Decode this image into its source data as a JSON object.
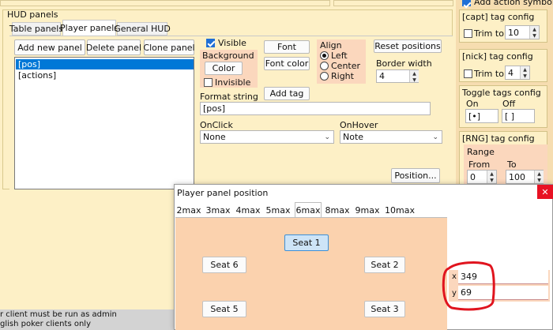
{
  "hud_panels": {
    "title": "HUD panels",
    "tabs": [
      {
        "label": "Table panels"
      },
      {
        "label": "Player panels"
      },
      {
        "label": "General HUD"
      }
    ],
    "buttons": {
      "add_new_panel": "Add new panel",
      "delete_panel": "Delete panel",
      "clone_panel": "Clone panel"
    },
    "panel_list": [
      "[pos]",
      "[actions]"
    ],
    "visible_label": "Visible",
    "background": {
      "title": "Background",
      "color_button": "Color",
      "invisible_label": "Invisible"
    },
    "font_button": "Font",
    "font_color_button": "Font color",
    "add_tag_button": "Add tag",
    "align": {
      "title": "Align",
      "options": [
        "Left",
        "Center",
        "Right"
      ],
      "selected": "Left"
    },
    "reset_positions_button": "Reset positions",
    "border_width": {
      "label": "Border width",
      "value": "4"
    },
    "format_string": {
      "label": "Format string",
      "value": "[pos]"
    },
    "on_click": {
      "label": "OnClick",
      "value": "None"
    },
    "on_hover": {
      "label": "OnHover",
      "value": "Note"
    },
    "position_button": "Position..."
  },
  "right_panel": {
    "add_action_symbol": "Add action symbol",
    "capt_config": {
      "title": "[capt] tag config",
      "trim_label": "Trim to",
      "trim_value": "10"
    },
    "nick_config": {
      "title": "[nick] tag config",
      "trim_label": "Trim to",
      "trim_value": "4"
    },
    "toggle_config": {
      "title": "Toggle tags config",
      "on_label": "On",
      "off_label": "Off",
      "on_value": "[•]",
      "off_value": "[ ]"
    },
    "rng_config": {
      "title": "[RNG] tag config",
      "range_label": "Range",
      "from_label": "From",
      "to_label": "To",
      "from_value": "0",
      "to_value": "100"
    }
  },
  "status": {
    "line1": "r client must be run as admin",
    "line2": "glish poker clients only"
  },
  "dialog": {
    "title": "Player panel position",
    "close_glyph": "✕",
    "tabs": [
      "2max",
      "3max",
      "4max",
      "5max",
      "6max",
      "8max",
      "9max",
      "10max"
    ],
    "selected_tab": "6max",
    "seats": [
      {
        "label": "Seat 1",
        "selected": true
      },
      {
        "label": "Seat 2",
        "selected": false
      },
      {
        "label": "Seat 3",
        "selected": false
      },
      {
        "label": "Seat 5",
        "selected": false
      },
      {
        "label": "Seat 6",
        "selected": false
      }
    ],
    "x_label": "x",
    "x_value": "349",
    "y_label": "y",
    "y_value": "69"
  },
  "colors": {
    "window_bg": "#fdf0c6",
    "peach": "#fbd7bd",
    "dialog_canvas": "#fbd2ae",
    "selection": "#0078d7",
    "annotation_red": "#e0141e"
  }
}
